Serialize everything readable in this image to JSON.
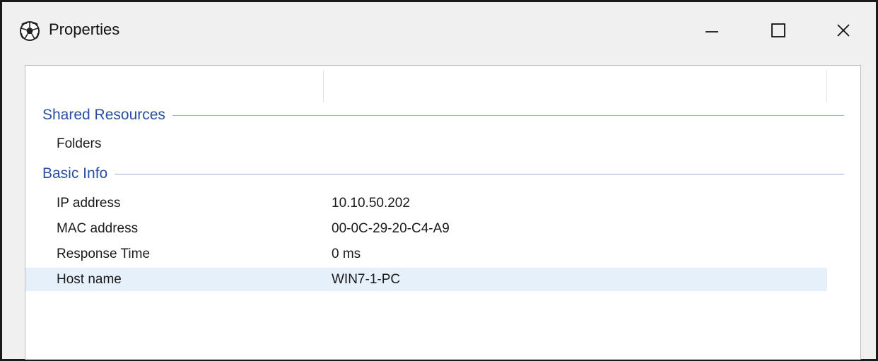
{
  "window": {
    "title": "Properties",
    "icon": "soccer-ball-icon",
    "controls": [
      "minimize-icon",
      "maximize-icon",
      "close-icon"
    ]
  },
  "groups": [
    {
      "header": "Shared Resources",
      "items": [
        {
          "label": "Folders",
          "value": ""
        }
      ]
    },
    {
      "header": "Basic Info",
      "items": [
        {
          "label": "IP address",
          "value": "10.10.50.202"
        },
        {
          "label": "MAC address",
          "value": "00-0C-29-20-C4-A9"
        },
        {
          "label": "Response Time",
          "value": "0 ms"
        },
        {
          "label": "Host name",
          "value": "WIN7-1-PC",
          "selected": true
        }
      ]
    }
  ],
  "colors": {
    "group_header": "#2a4fa0",
    "selection": "#e5f0fb"
  }
}
